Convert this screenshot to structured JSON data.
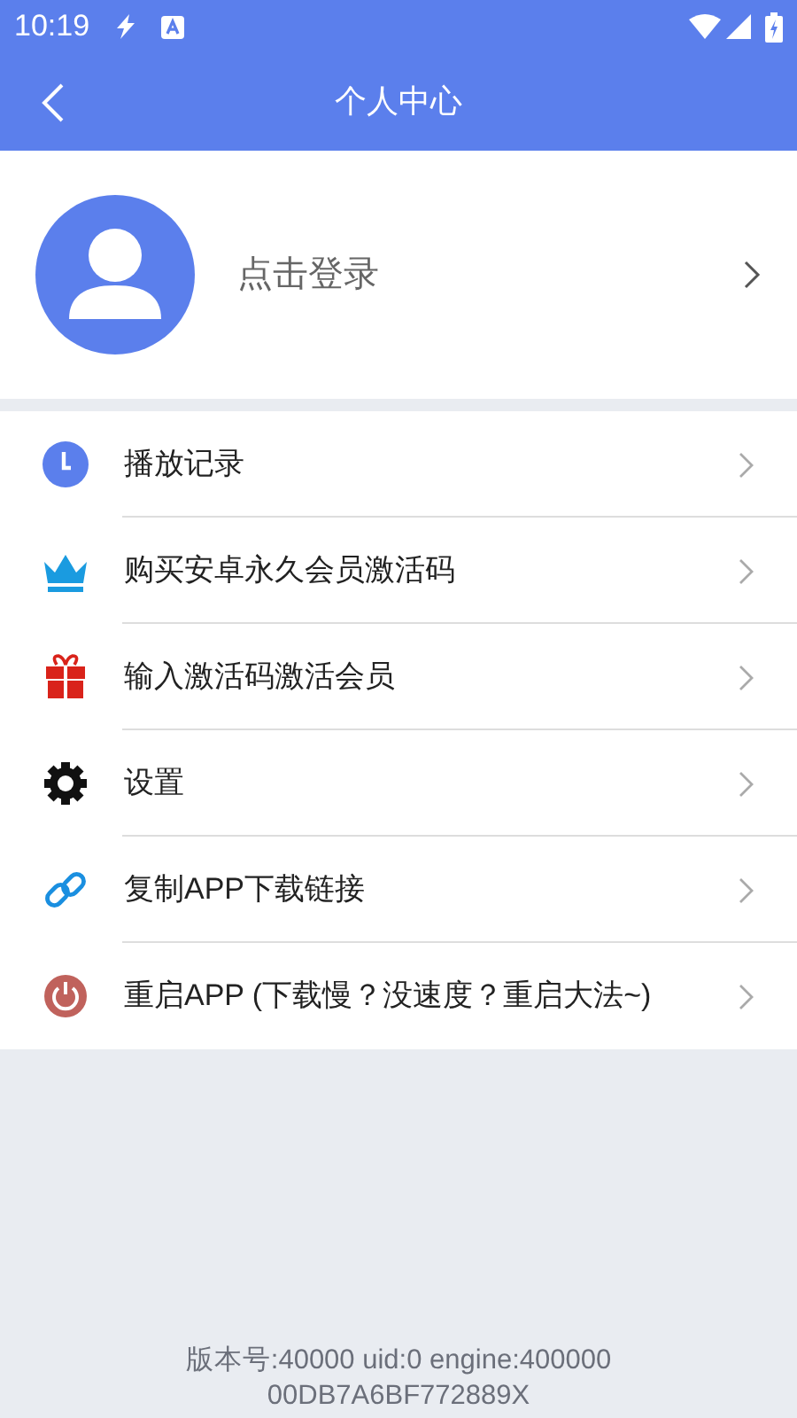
{
  "status_bar": {
    "time": "10:19"
  },
  "app_bar": {
    "title": "个人中心"
  },
  "profile": {
    "login_label": "点击登录"
  },
  "menu": [
    {
      "kind": "history",
      "label": "播放记录"
    },
    {
      "kind": "vip",
      "label": "购买安卓永久会员激活码"
    },
    {
      "kind": "gift",
      "label": "输入激活码激活会员"
    },
    {
      "kind": "settings",
      "label": "设置"
    },
    {
      "kind": "link",
      "label": "复制APP下载链接"
    },
    {
      "kind": "restart",
      "label": "重启APP (下载慢？没速度？重启大法~)"
    }
  ],
  "footer": [
    "版本号:40000 uid:0 engine:400000",
    "00DB7A6BF772889X"
  ]
}
